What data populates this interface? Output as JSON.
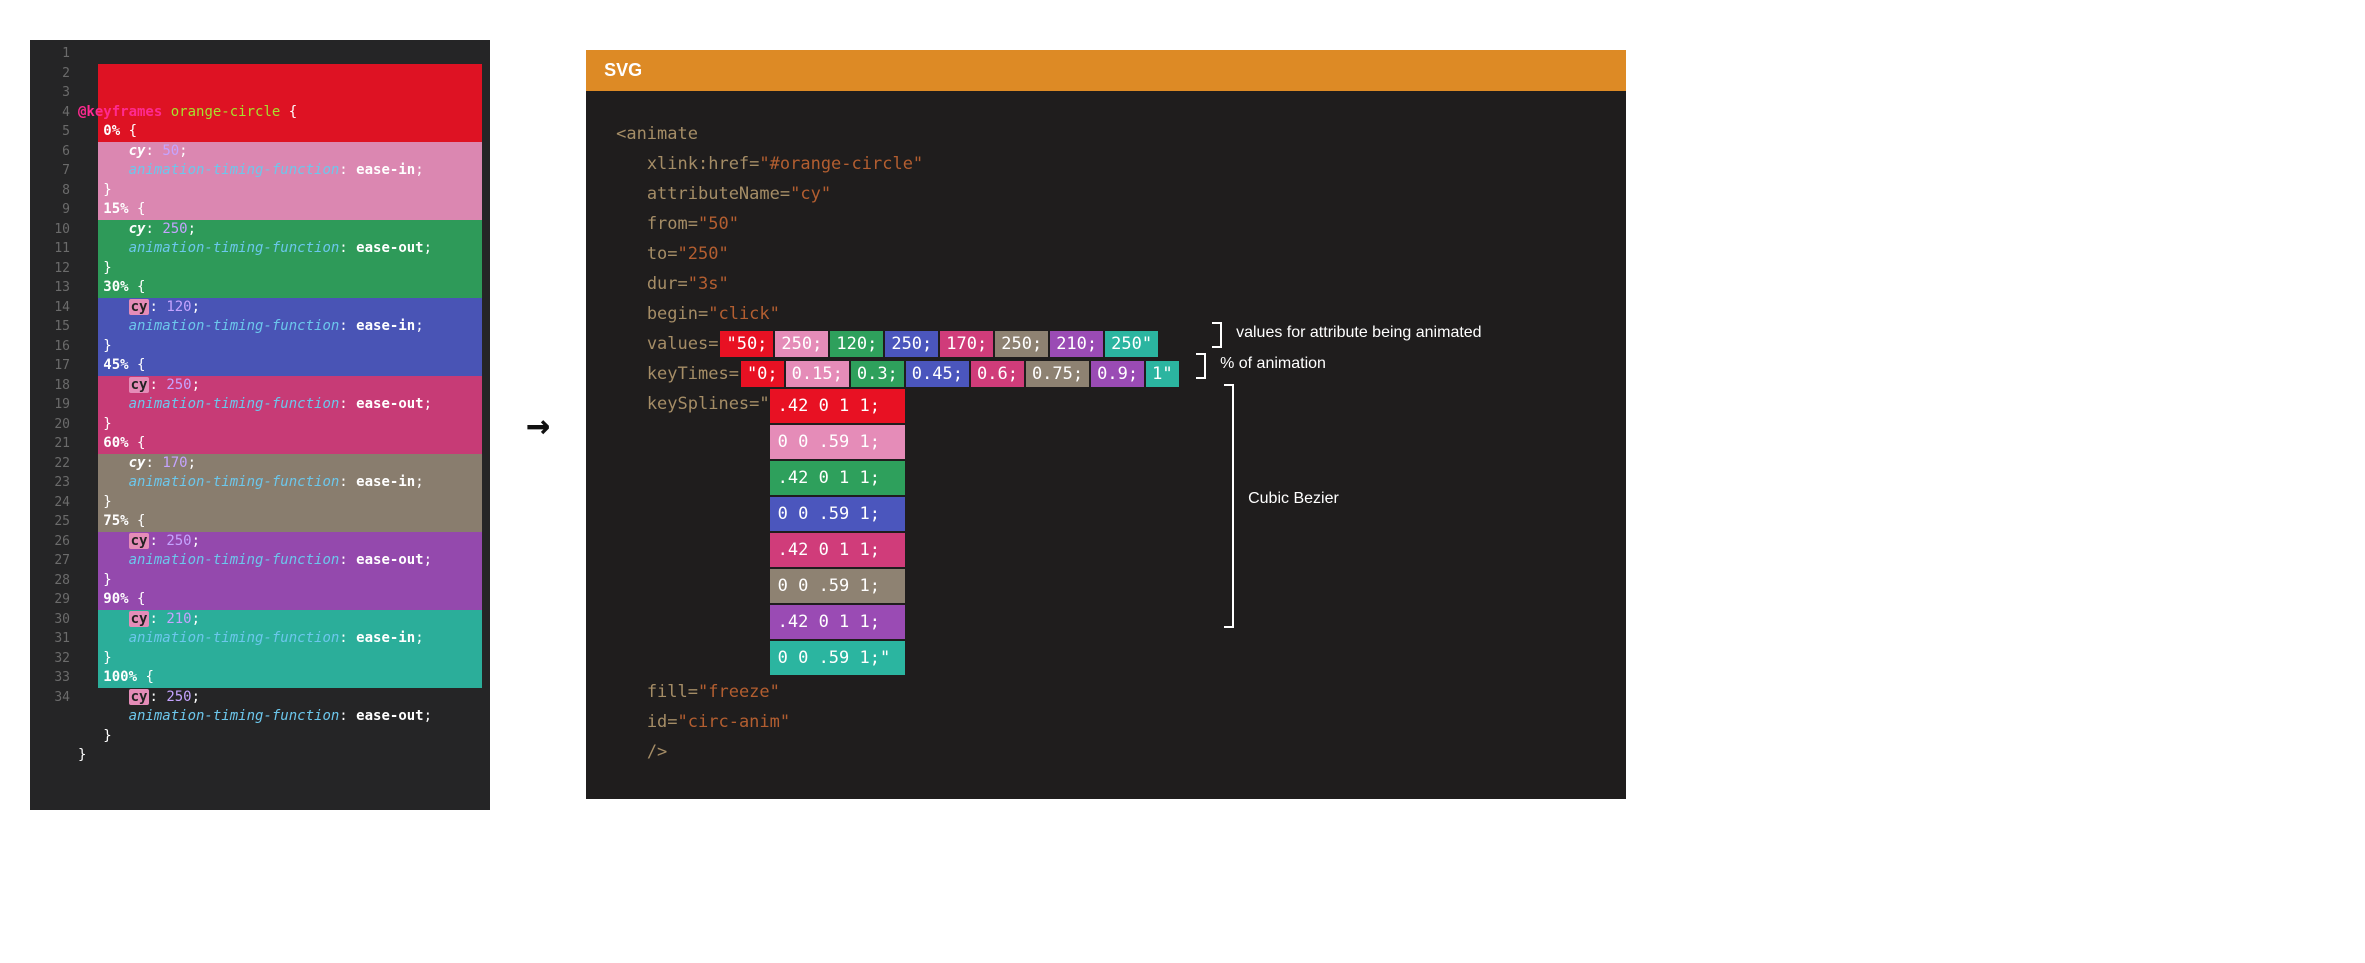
{
  "left": {
    "line_count": 34,
    "header_kw": "@keyframes",
    "anim_name": "orange-circle",
    "open_brace": "{",
    "close_brace": "}",
    "frames": [
      {
        "pct": "0%",
        "cy": "50",
        "timing": "ease-in",
        "colorClass": "c0",
        "cyBoxed": false
      },
      {
        "pct": "15%",
        "cy": "250",
        "timing": "ease-out",
        "colorClass": "c1",
        "cyBoxed": false
      },
      {
        "pct": "30%",
        "cy": "120",
        "timing": "ease-in",
        "colorClass": "c2",
        "cyBoxed": true
      },
      {
        "pct": "45%",
        "cy": "250",
        "timing": "ease-out",
        "colorClass": "c3",
        "cyBoxed": true
      },
      {
        "pct": "60%",
        "cy": "170",
        "timing": "ease-in",
        "colorClass": "c4",
        "cyBoxed": false
      },
      {
        "pct": "75%",
        "cy": "250",
        "timing": "ease-out",
        "colorClass": "c5",
        "cyBoxed": true
      },
      {
        "pct": "90%",
        "cy": "210",
        "timing": "ease-in",
        "colorClass": "c6",
        "cyBoxed": true
      },
      {
        "pct": "100%",
        "cy": "250",
        "timing": "ease-out",
        "colorClass": "c7",
        "cyBoxed": true
      }
    ]
  },
  "arrow": "→",
  "right": {
    "heading": "SVG",
    "tag_open": "<animate",
    "attrs_plain": [
      {
        "name": "xlink:href",
        "value": "\"#orange-circle\""
      },
      {
        "name": "attributeName",
        "value": "\"cy\""
      },
      {
        "name": "from",
        "value": "\"50\""
      },
      {
        "name": "to",
        "value": "\"250\""
      },
      {
        "name": "dur",
        "value": "\"3s\""
      },
      {
        "name": "begin",
        "value": "\"click\""
      }
    ],
    "values_label": "values=",
    "values_lead": "\"50;",
    "values": [
      {
        "text": "250;",
        "c": "c1"
      },
      {
        "text": "120;",
        "c": "c2"
      },
      {
        "text": "250;",
        "c": "c3"
      },
      {
        "text": "170;",
        "c": "c4"
      },
      {
        "text": "250;",
        "c": "c5"
      },
      {
        "text": "210;",
        "c": "c6"
      },
      {
        "text": "250\"",
        "c": "c7"
      }
    ],
    "keyTimes_label": "keyTimes=",
    "keyTimes_lead": "\"0;",
    "keyTimes": [
      {
        "text": "0.15;",
        "c": "c1"
      },
      {
        "text": "0.3;",
        "c": "c2"
      },
      {
        "text": "0.45;",
        "c": "c3"
      },
      {
        "text": "0.6;",
        "c": "c4"
      },
      {
        "text": "0.75;",
        "c": "c5"
      },
      {
        "text": "0.9;",
        "c": "c6"
      },
      {
        "text": "1\"",
        "c": "c7"
      }
    ],
    "keySplines_label": "keySplines=\"",
    "keySplines": [
      {
        "text": ".42 0 1 1;",
        "c": "c0"
      },
      {
        "text": "0 0 .59 1;",
        "c": "c1"
      },
      {
        "text": ".42 0 1 1;",
        "c": "c2"
      },
      {
        "text": "0 0 .59 1;",
        "c": "c3"
      },
      {
        "text": ".42 0 1 1;",
        "c": "c4"
      },
      {
        "text": "0 0 .59 1;",
        "c": "c5"
      },
      {
        "text": ".42 0 1 1;",
        "c": "c6"
      },
      {
        "text": "0 0 .59 1;\"",
        "c": "c7"
      }
    ],
    "attrs_tail": [
      {
        "name": "fill",
        "value": "\"freeze\""
      },
      {
        "name": "id",
        "value": "\"circ-anim\""
      }
    ],
    "tag_close": "/>",
    "annotations": {
      "values": "values for attribute being animated",
      "keyTimes": "% of animation",
      "keySplines": "Cubic Bezier"
    }
  }
}
